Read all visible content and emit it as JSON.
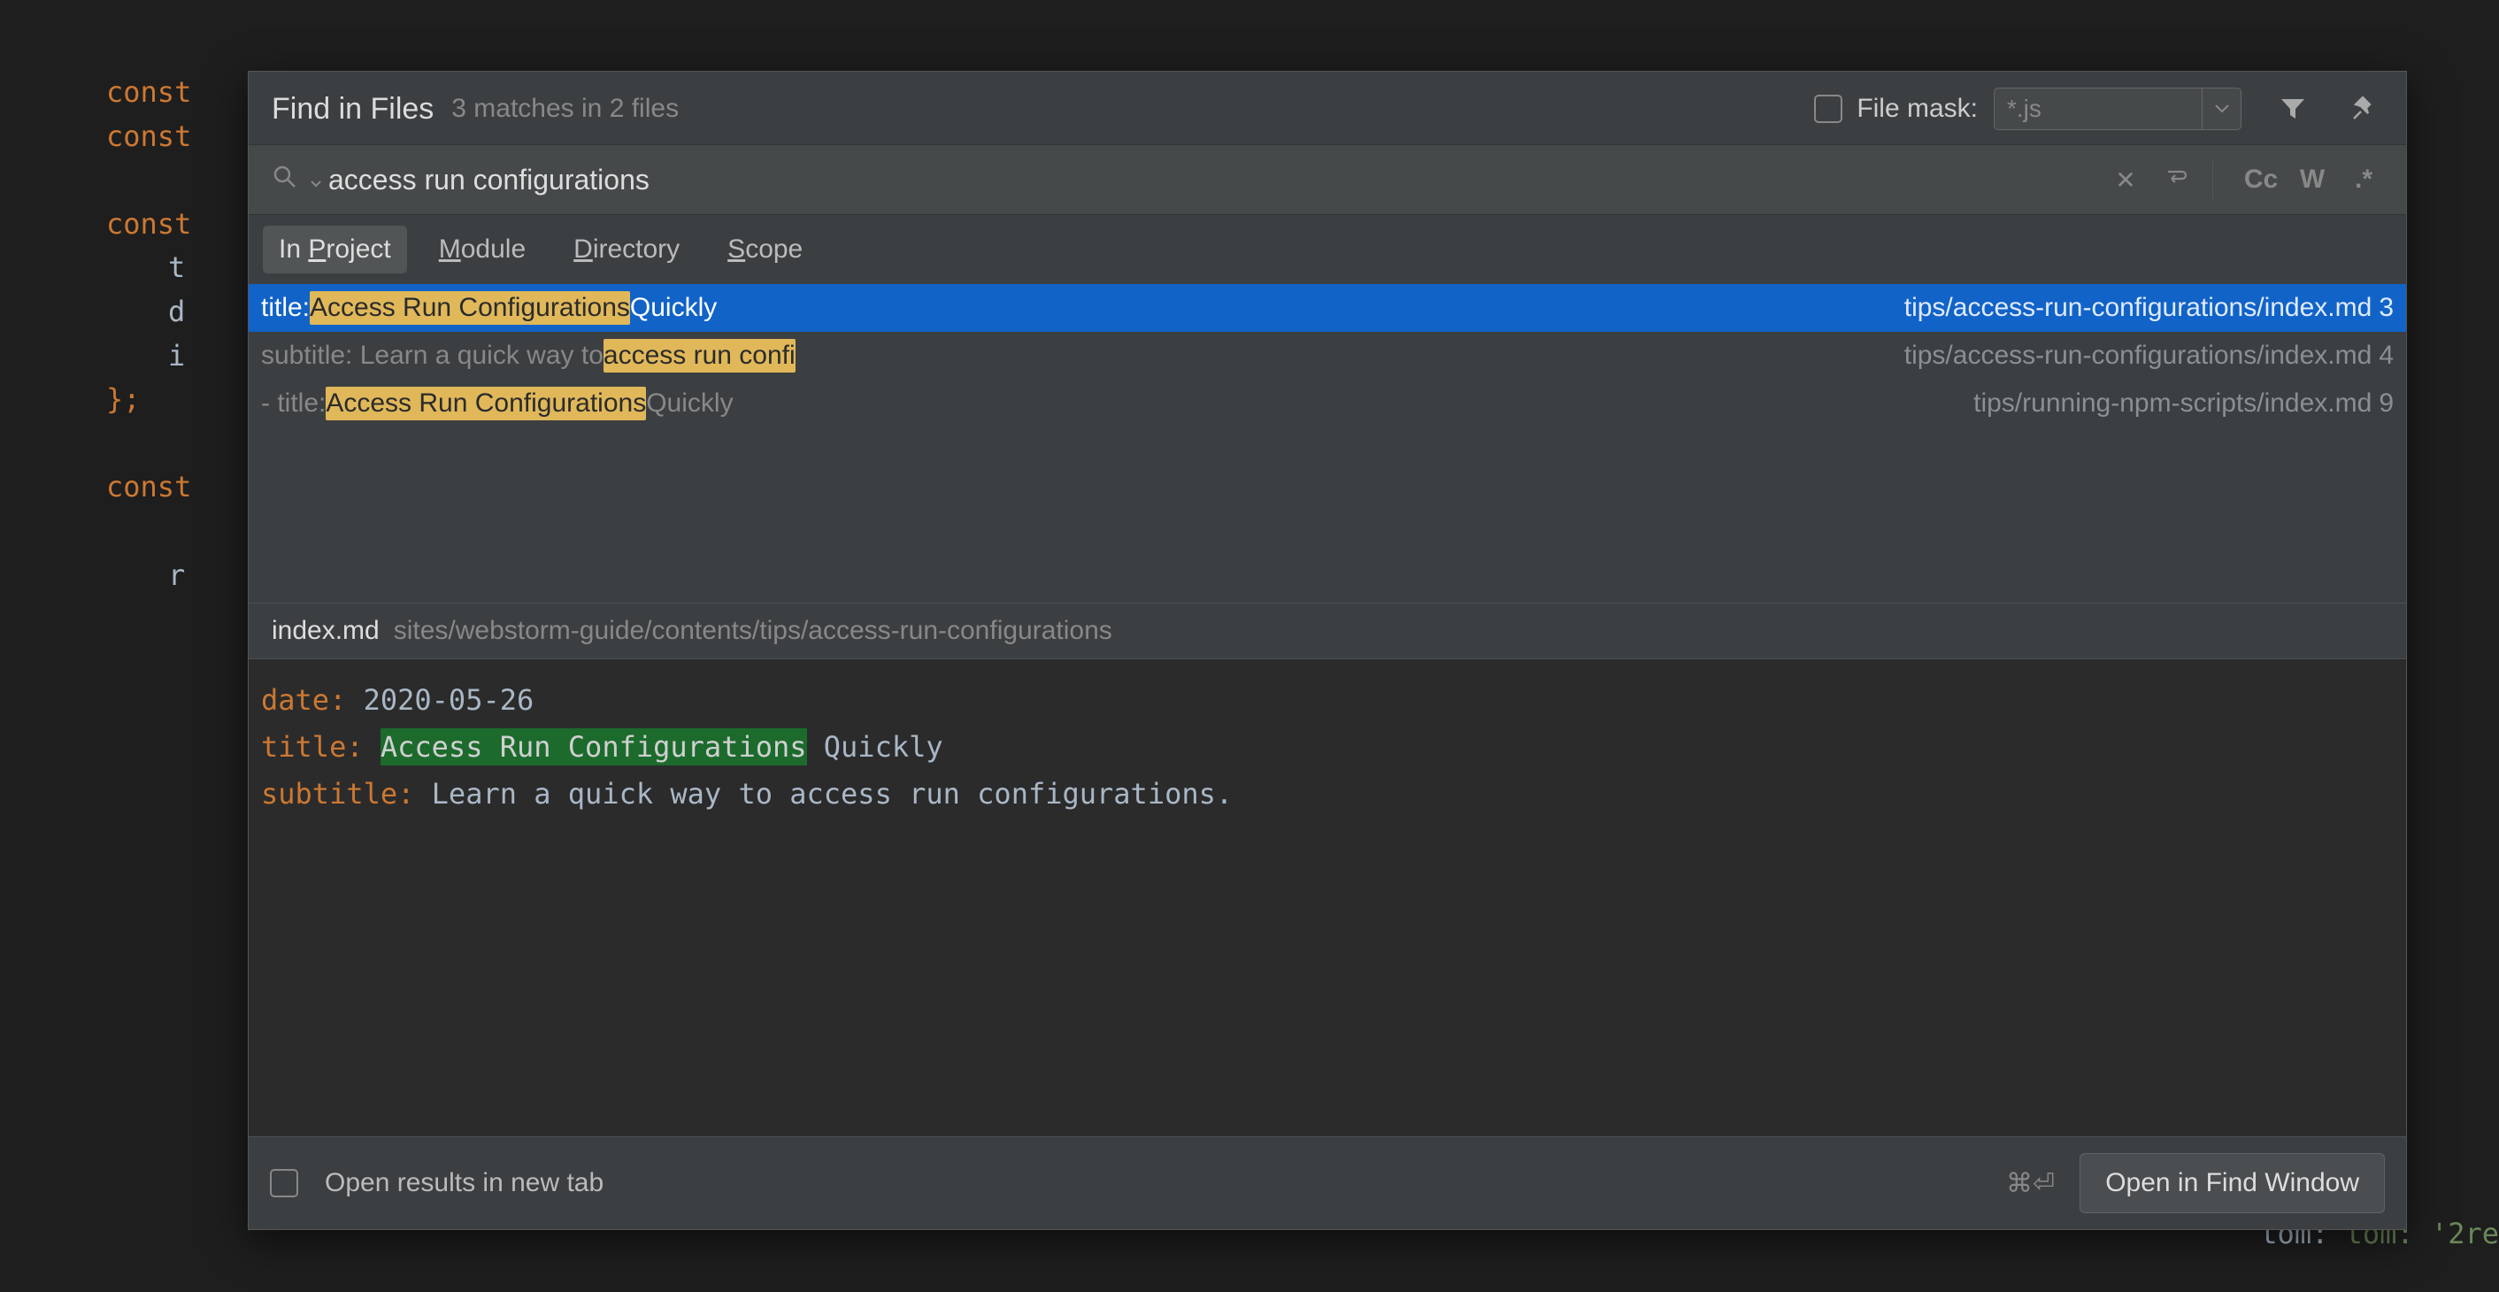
{
  "background": {
    "lines": [
      {
        "type": "kw",
        "text": "const"
      },
      {
        "type": "kw",
        "text": "const"
      },
      {
        "type": "blank",
        "text": ""
      },
      {
        "type": "kw",
        "text": "const"
      },
      {
        "type": "indent",
        "text": "t"
      },
      {
        "type": "indent",
        "text": "d"
      },
      {
        "type": "indent",
        "text": "i"
      },
      {
        "type": "close",
        "text": "};"
      },
      {
        "type": "blank",
        "text": ""
      },
      {
        "type": "kw",
        "text": "const"
      },
      {
        "type": "blank",
        "text": ""
      },
      {
        "type": "indent",
        "text": "r"
      }
    ],
    "tail": "tom: '2re"
  },
  "header": {
    "title": "Find in Files",
    "subtitle": "3 matches in 2 files",
    "file_mask_label": "File mask:",
    "file_mask_value": "*.js"
  },
  "search": {
    "value": "access run configurations",
    "cc": "Cc",
    "w": "W",
    "regex": ".*"
  },
  "scopes": [
    {
      "label": "In Project",
      "active": true,
      "u": "P"
    },
    {
      "label": "Module",
      "active": false,
      "u": "M"
    },
    {
      "label": "Directory",
      "active": false,
      "u": "D"
    },
    {
      "label": "Scope",
      "active": false,
      "u": "S"
    }
  ],
  "results": [
    {
      "prefix": "title: ",
      "highlight": "Access Run Configurations",
      "suffix": " Quickly",
      "path": "tips/access-run-configurations/index.md",
      "line": "3",
      "selected": true
    },
    {
      "prefix": "subtitle: Learn a quick way to ",
      "highlight": "access run confi",
      "suffix": "",
      "path": "tips/access-run-configurations/index.md",
      "line": "4",
      "selected": false
    },
    {
      "prefix": "- title: ",
      "highlight": "Access Run Configurations",
      "suffix": " Quickly",
      "path": "tips/running-npm-scripts/index.md",
      "line": "9",
      "selected": false
    }
  ],
  "preview": {
    "file": "index.md",
    "dir": "sites/webstorm-guide/contents/tips/access-run-configurations",
    "lines": {
      "date_key": "date:",
      "date_val": "2020-05-26",
      "title_key": "title:",
      "title_hl": "Access Run Configurations",
      "title_suffix": "Quickly",
      "subtitle_key": "subtitle:",
      "subtitle_val": "Learn a quick way to access run configurations."
    }
  },
  "footer": {
    "open_tab_label": "Open results in new tab",
    "shortcut": "⌘⏎",
    "open_find_window": "Open in Find Window"
  }
}
